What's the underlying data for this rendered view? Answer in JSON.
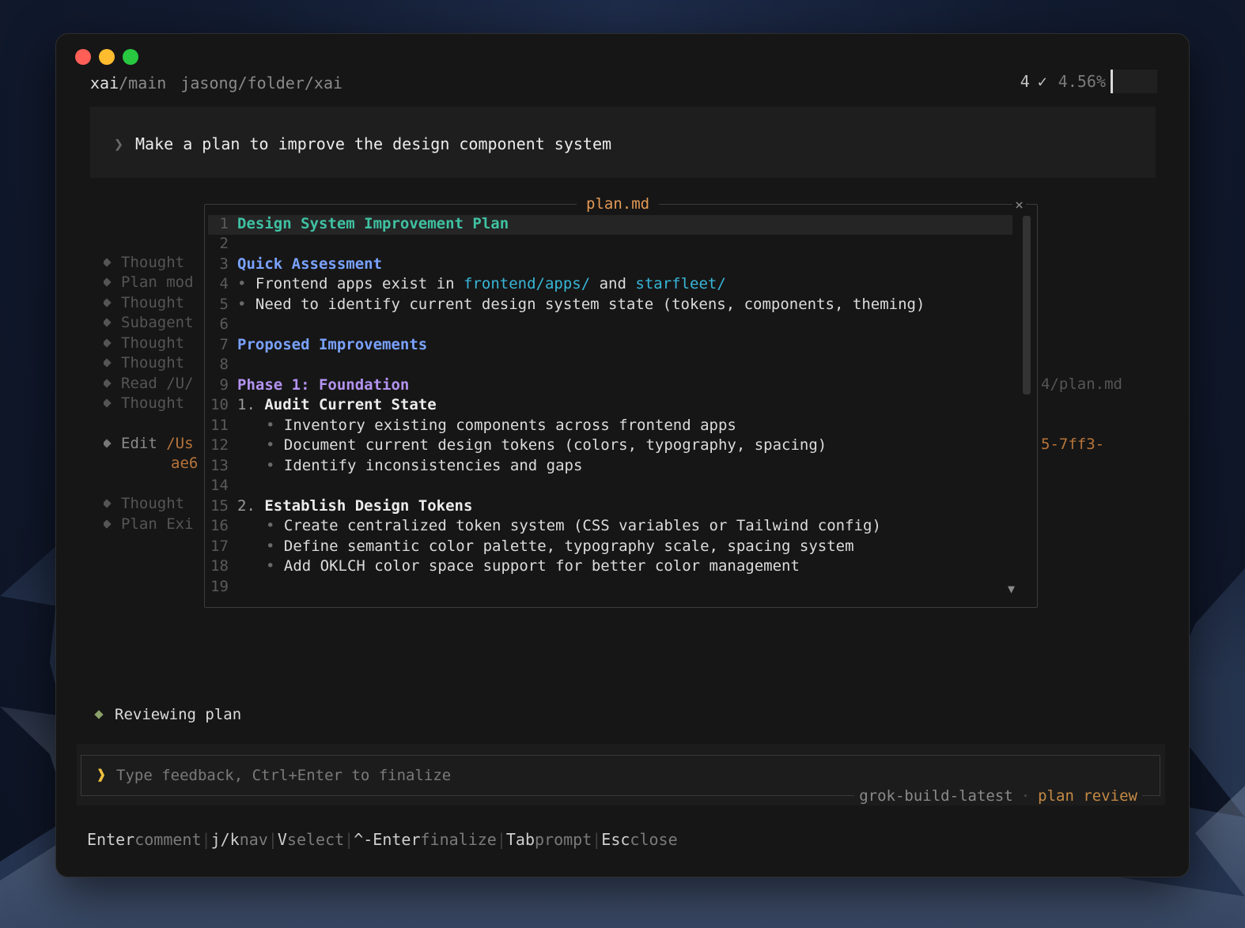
{
  "topbar": {
    "repo": "xai",
    "branch": "/main",
    "cwd": "jasong/folder/xai",
    "count": "4",
    "check": "✓",
    "percent": "4.56%"
  },
  "prompt": {
    "caret": "❯",
    "text": "Make a plan to improve the design component system"
  },
  "history": {
    "items": [
      {
        "label": "Thought"
      },
      {
        "label": "Plan mod"
      },
      {
        "label": "Thought"
      },
      {
        "label": "Subagent"
      },
      {
        "label": "Thought"
      },
      {
        "label": "Thought"
      },
      {
        "label": "Read /U/"
      },
      {
        "label": "Thought"
      },
      {
        "label": "Edit ",
        "path": "/Us"
      },
      {
        "label": "Thought"
      },
      {
        "label": "Plan Exi"
      }
    ],
    "edit_continuation": "ae6",
    "read_right_fragment": "4/plan.md",
    "edit_right_fragment": "5-7ff3-"
  },
  "plan": {
    "title": "plan.md",
    "close": "×",
    "scroll_down": "▼",
    "lines": [
      {
        "n": "1",
        "text": "Design System Improvement Plan"
      },
      {
        "n": "2",
        "text": ""
      },
      {
        "n": "3",
        "text": "Quick Assessment"
      },
      {
        "n": "4",
        "bullet": "•",
        "pre": "Frontend apps exist in ",
        "link1": "frontend/apps/",
        "mid": " and ",
        "link2": "starfleet/"
      },
      {
        "n": "5",
        "bullet": "•",
        "text": "Need to identify current design system state (tokens, components, theming)"
      },
      {
        "n": "6",
        "text": ""
      },
      {
        "n": "7",
        "text": "Proposed Improvements"
      },
      {
        "n": "8",
        "text": ""
      },
      {
        "n": "9",
        "text": "Phase 1: Foundation"
      },
      {
        "n": "10",
        "num": "1.",
        "text": "Audit Current State"
      },
      {
        "n": "11",
        "bullet": "•",
        "text": "Inventory existing components across frontend apps"
      },
      {
        "n": "12",
        "bullet": "•",
        "text": "Document current design tokens (colors, typography, spacing)"
      },
      {
        "n": "13",
        "bullet": "•",
        "text": "Identify inconsistencies and gaps"
      },
      {
        "n": "14",
        "text": ""
      },
      {
        "n": "15",
        "num": "2.",
        "text": "Establish Design Tokens"
      },
      {
        "n": "16",
        "bullet": "•",
        "text": "Create centralized token system (CSS variables or Tailwind config)"
      },
      {
        "n": "17",
        "bullet": "•",
        "text": "Define semantic color palette, typography scale, spacing system"
      },
      {
        "n": "18",
        "bullet": "•",
        "text": "Add OKLCH color space support for better color management"
      },
      {
        "n": "19",
        "text": ""
      }
    ]
  },
  "status": {
    "text": "Reviewing plan"
  },
  "input": {
    "caret": "❱",
    "placeholder": "Type feedback, Ctrl+Enter to finalize",
    "model": "grok-build-latest",
    "separator": "·",
    "mode": "plan review"
  },
  "shortcuts": [
    {
      "key": "Enter",
      "desc": "comment"
    },
    {
      "key": "j/k",
      "desc": "nav"
    },
    {
      "key": "V",
      "desc": "select"
    },
    {
      "key": "^-Enter",
      "desc": "finalize"
    },
    {
      "key": "Tab",
      "desc": "prompt"
    },
    {
      "key": "Esc",
      "desc": "close"
    }
  ],
  "shortcut_separator": "|",
  "colors": {
    "accent_orange": "#e39a55",
    "title_teal": "#3fc1a2",
    "heading_blue": "#7aa2ff",
    "heading_purple": "#b493f0",
    "link_cyan": "#38b6d8",
    "status_green": "#8aa16a",
    "caret_yellow": "#f0c040"
  }
}
